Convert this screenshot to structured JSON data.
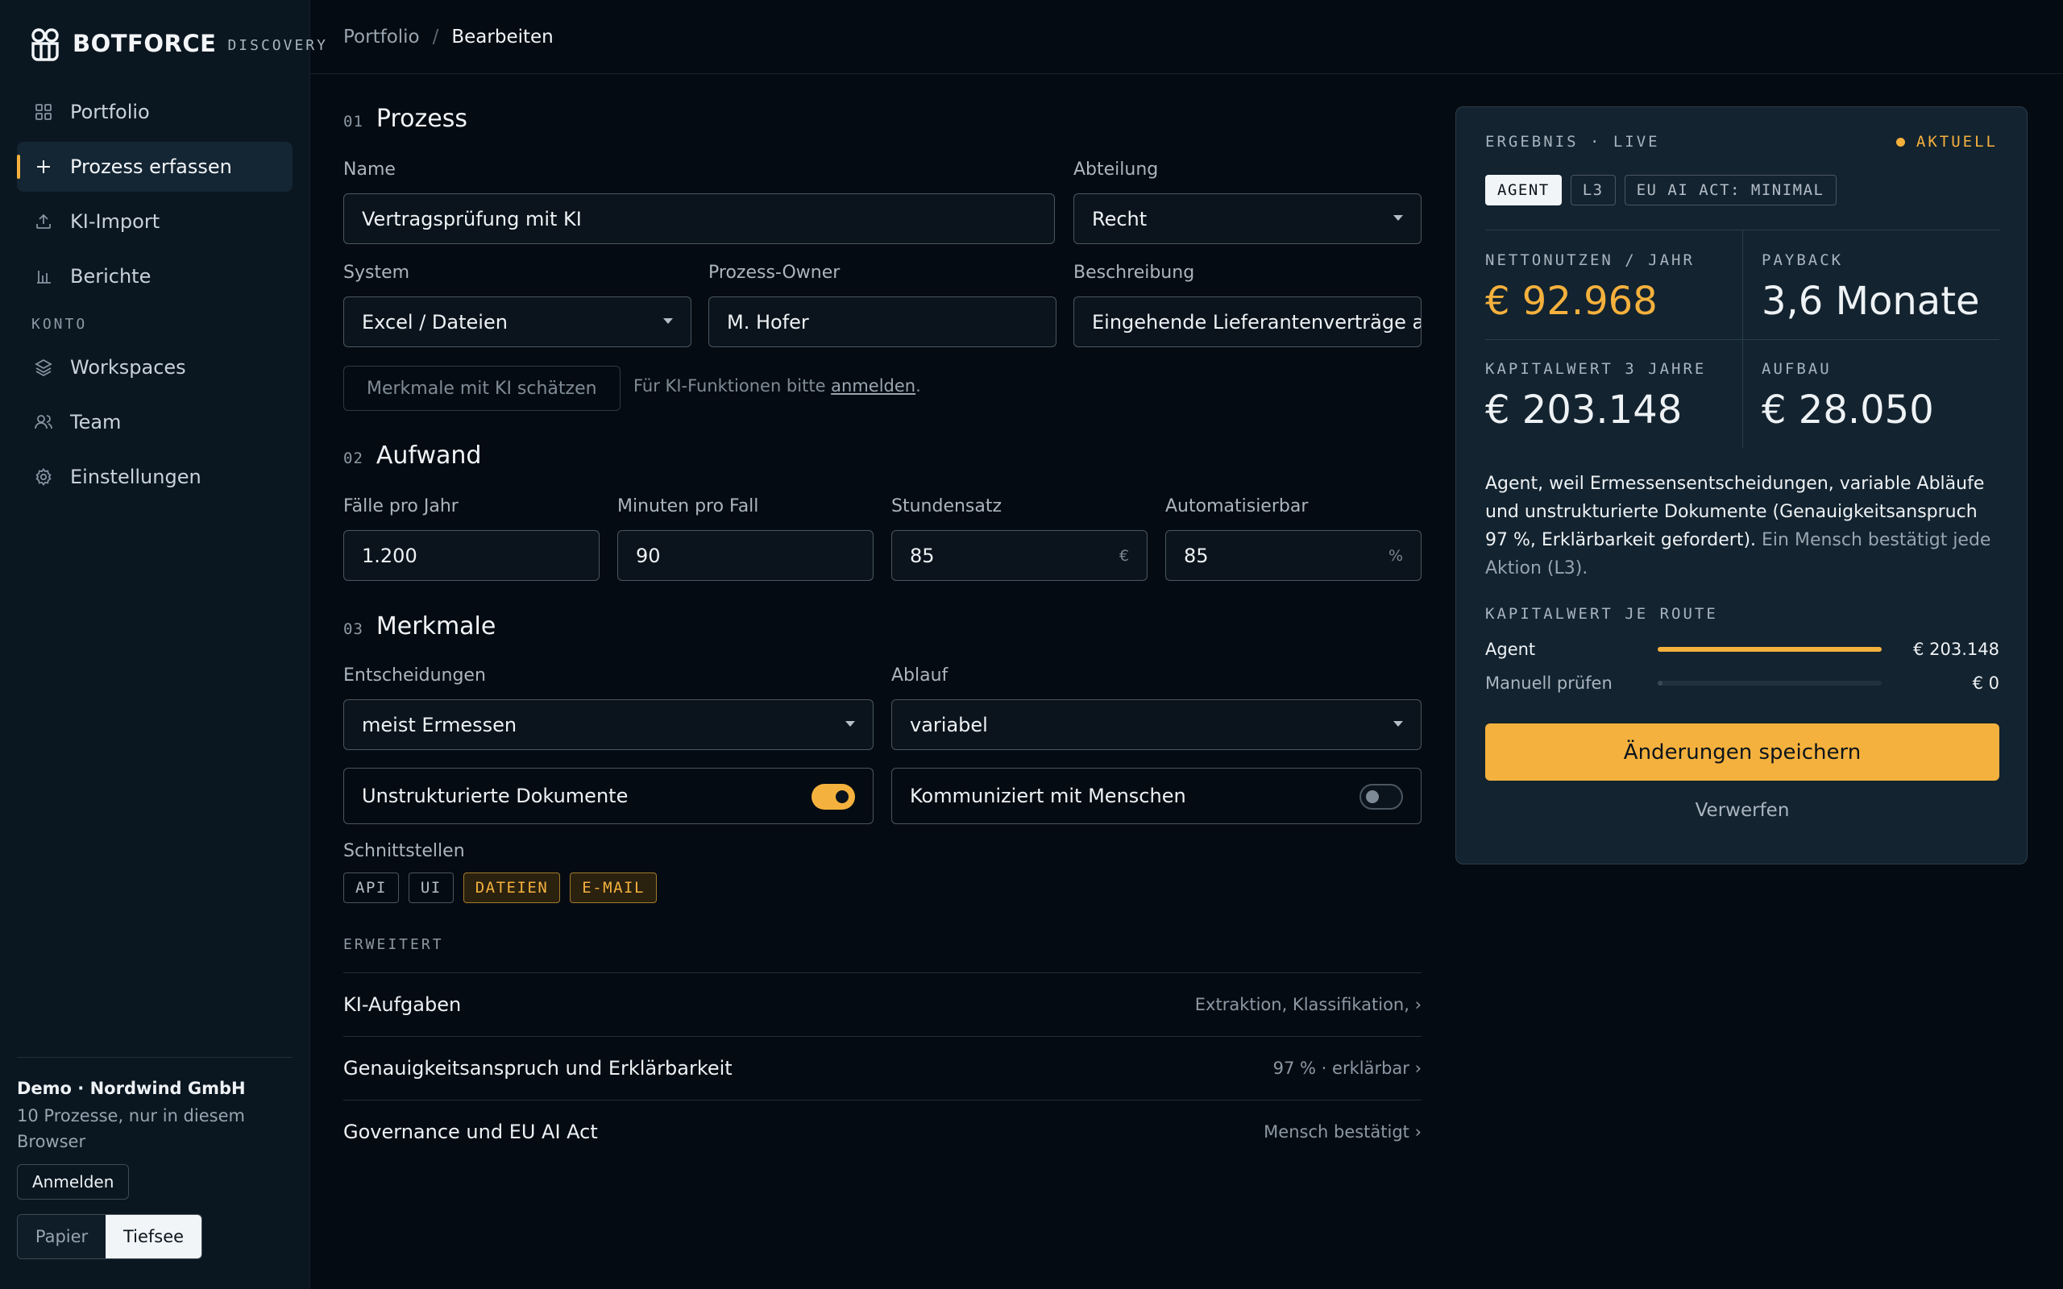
{
  "brand": {
    "name": "BOTFORCE",
    "sub": "DISCOVERY"
  },
  "nav": {
    "items": [
      {
        "label": "Portfolio",
        "icon": "grid-icon"
      },
      {
        "label": "Prozess erfassen",
        "icon": "plus-icon"
      },
      {
        "label": "KI-Import",
        "icon": "upload-icon"
      },
      {
        "label": "Berichte",
        "icon": "bar-chart-icon"
      }
    ],
    "account_label": "KONTO",
    "account_items": [
      {
        "label": "Workspaces",
        "icon": "layers-icon"
      },
      {
        "label": "Team",
        "icon": "users-icon"
      },
      {
        "label": "Einstellungen",
        "icon": "gear-icon"
      }
    ]
  },
  "sidebar_footer": {
    "title": "Demo · Nordwind GmbH",
    "subtitle": "10 Prozesse, nur in diesem Browser",
    "login": "Anmelden",
    "theme_paper": "Papier",
    "theme_deep": "Tiefsee"
  },
  "breadcrumb": {
    "parent": "Portfolio",
    "sep": "/",
    "current": "Bearbeiten"
  },
  "sections": {
    "prozess": {
      "num": "01",
      "title": "Prozess"
    },
    "aufwand": {
      "num": "02",
      "title": "Aufwand"
    },
    "merkmale": {
      "num": "03",
      "title": "Merkmale"
    }
  },
  "form": {
    "name_label": "Name",
    "name_value": "Vertragsprüfung mit KI",
    "abteilung_label": "Abteilung",
    "abteilung_value": "Recht",
    "system_label": "System",
    "system_value": "Excel / Dateien",
    "owner_label": "Prozess-Owner",
    "owner_value": "M. Hofer",
    "beschreibung_label": "Beschreibung",
    "beschreibung_value": "Eingehende Lieferantenverträge a",
    "ai_button": "Merkmale mit KI schätzen",
    "ai_hint_prefix": "Für KI-Funktionen bitte ",
    "ai_hint_link": "anmelden",
    "ai_hint_suffix": ".",
    "faelle_label": "Fälle pro Jahr",
    "faelle_value": "1.200",
    "minuten_label": "Minuten pro Fall",
    "minuten_value": "90",
    "stundensatz_label": "Stundensatz",
    "stundensatz_value": "85",
    "stundensatz_unit": "€",
    "auto_label": "Automatisierbar",
    "auto_value": "85",
    "auto_unit": "%",
    "entscheidungen_label": "Entscheidungen",
    "entscheidungen_value": "meist Ermessen",
    "ablauf_label": "Ablauf",
    "ablauf_value": "variabel",
    "toggle_docs_label": "Unstrukturierte Dokumente",
    "toggle_docs_on": true,
    "toggle_human_label": "Kommuniziert mit Menschen",
    "toggle_human_on": false,
    "schnittstellen_label": "Schnittstellen",
    "chips": [
      {
        "label": "API",
        "on": false
      },
      {
        "label": "UI",
        "on": false
      },
      {
        "label": "DATEIEN",
        "on": true
      },
      {
        "label": "E-MAIL",
        "on": true
      }
    ],
    "advanced_label": "ERWEITERT",
    "advanced": [
      {
        "title": "KI-Aufgaben",
        "value": "Extraktion, Klassifikation, ›"
      },
      {
        "title": "Genauigkeitsanspruch und Erklärbarkeit",
        "value": "97 % · erklärbar ›"
      },
      {
        "title": "Governance und EU AI Act",
        "value": "Mensch bestätigt ›"
      }
    ]
  },
  "result": {
    "head": "ERGEBNIS · LIVE",
    "status": "AKTUELL",
    "badges": [
      "AGENT",
      "L3",
      "EU AI ACT: MINIMAL"
    ],
    "kpis": {
      "netto_label": "NETTONUTZEN / JAHR",
      "netto_value": "€ 92.968",
      "payback_label": "PAYBACK",
      "payback_value": "3,6 Monate",
      "kapital_label": "KAPITALWERT 3 JAHRE",
      "kapital_value": "€ 203.148",
      "aufbau_label": "AUFBAU",
      "aufbau_value": "€ 28.050"
    },
    "explain_main": "Agent, weil Ermessensentscheidungen, variable Abläufe und unstrukturierte Dokumente (Genauigkeitsanspruch 97 %, Erklärbarkeit gefordert).",
    "explain_dim": " Ein Mensch bestätigt jede Aktion (L3).",
    "route_label": "KAPITALWERT JE ROUTE",
    "routes": [
      {
        "name": "Agent",
        "value": "€ 203.148",
        "share": 1.0
      },
      {
        "name": "Manuell prüfen",
        "value": "€ 0",
        "share": 0.0
      }
    ],
    "save": "Änderungen speichern",
    "discard": "Verwerfen"
  },
  "colors": {
    "accent": "#f5b13d",
    "bg": "#050b12",
    "panel": "#13232f"
  }
}
